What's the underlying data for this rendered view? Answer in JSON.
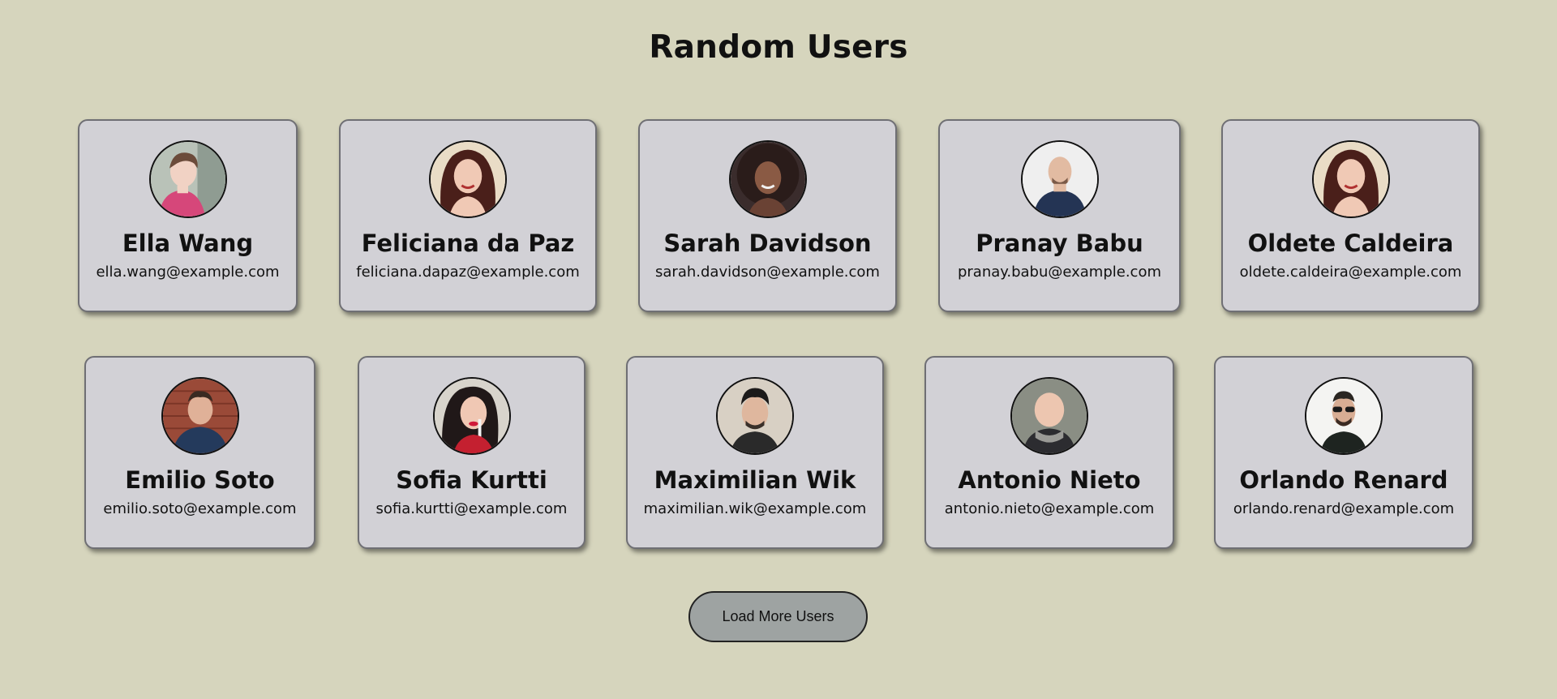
{
  "page": {
    "title": "Random Users",
    "background_color": "#d6d5bd"
  },
  "users": [
    {
      "name": "Ella Wang",
      "email": "ella.wang@example.com",
      "avatar_icon": "avatar-photo-icon"
    },
    {
      "name": "Feliciana da Paz",
      "email": "feliciana.dapaz@example.com",
      "avatar_icon": "avatar-photo-icon"
    },
    {
      "name": "Sarah Davidson",
      "email": "sarah.davidson@example.com",
      "avatar_icon": "avatar-photo-icon"
    },
    {
      "name": "Pranay Babu",
      "email": "pranay.babu@example.com",
      "avatar_icon": "avatar-photo-icon"
    },
    {
      "name": "Oldete Caldeira",
      "email": "oldete.caldeira@example.com",
      "avatar_icon": "avatar-photo-icon"
    },
    {
      "name": "Emilio Soto",
      "email": "emilio.soto@example.com",
      "avatar_icon": "avatar-photo-icon"
    },
    {
      "name": "Sofia Kurtti",
      "email": "sofia.kurtti@example.com",
      "avatar_icon": "avatar-photo-icon"
    },
    {
      "name": "Maximilian Wik",
      "email": "maximilian.wik@example.com",
      "avatar_icon": "avatar-photo-icon"
    },
    {
      "name": "Antonio Nieto",
      "email": "antonio.nieto@example.com",
      "avatar_icon": "avatar-photo-icon"
    },
    {
      "name": "Orlando Renard",
      "email": "orlando.renard@example.com",
      "avatar_icon": "avatar-photo-icon"
    }
  ],
  "load_more": {
    "label": "Load More Users",
    "color": "#9ea3a2"
  },
  "colors": {
    "card_background": "#d2d1d6",
    "card_border": "#6f6f74"
  }
}
